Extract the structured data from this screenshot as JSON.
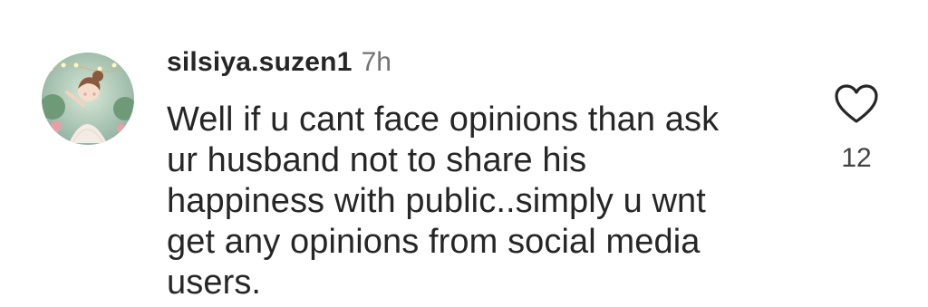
{
  "comment": {
    "username": "silsiya.suzen1",
    "timestamp": "7h",
    "text_lines": [
      "Well if u cant face opinions than ask",
      "ur husband not to share his",
      "happiness with public..simply u wnt",
      "get any opinions from social media",
      "users."
    ],
    "like_count": "12",
    "avatar_icon": "avatar-illustration-girl",
    "like_icon": "heart-outline-icon"
  },
  "colors": {
    "text_primary": "#262626",
    "text_secondary": "#737373",
    "background": "#ffffff"
  }
}
